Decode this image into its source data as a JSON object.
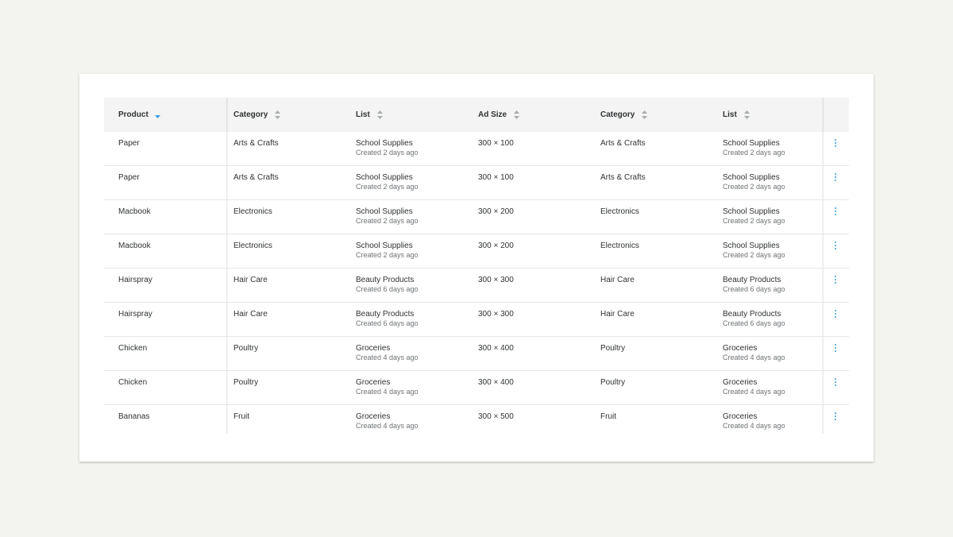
{
  "colors": {
    "background": "#f3f3ef",
    "card": "#ffffff",
    "header_bg": "#f4f4f4",
    "accent": "#3aa0e0",
    "text": "#2f3234",
    "muted": "#6e7275"
  },
  "table": {
    "sorted_column": "Product",
    "sort_direction": "descending",
    "headers": [
      "Product",
      "Category",
      "List",
      "Ad Size",
      "Category",
      "List"
    ],
    "rows": [
      {
        "product": "Paper",
        "category": "Arts & Crafts",
        "list": "School Supplies",
        "list_created": "Created 2 days ago",
        "ad_size": "300 × 100",
        "category2": "Arts & Crafts",
        "list2": "School Supplies",
        "list2_created": "Created 2 days ago"
      },
      {
        "product": "Paper",
        "category": "Arts & Crafts",
        "list": "School Supplies",
        "list_created": "Created 2 days ago",
        "ad_size": "300 × 100",
        "category2": "Arts & Crafts",
        "list2": "School Supplies",
        "list2_created": "Created 2 days ago"
      },
      {
        "product": "Macbook",
        "category": "Electronics",
        "list": "School Supplies",
        "list_created": "Created 2 days ago",
        "ad_size": "300 × 200",
        "category2": "Electronics",
        "list2": "School Supplies",
        "list2_created": "Created 2 days ago"
      },
      {
        "product": "Macbook",
        "category": "Electronics",
        "list": "School Supplies",
        "list_created": "Created 2 days ago",
        "ad_size": "300 × 200",
        "category2": "Electronics",
        "list2": "School Supplies",
        "list2_created": "Created 2 days ago"
      },
      {
        "product": "Hairspray",
        "category": "Hair Care",
        "list": "Beauty Products",
        "list_created": "Created 6 days ago",
        "ad_size": "300 × 300",
        "category2": "Hair Care",
        "list2": "Beauty Products",
        "list2_created": "Created 6 days ago"
      },
      {
        "product": "Hairspray",
        "category": "Hair Care",
        "list": "Beauty Products",
        "list_created": "Created 6 days ago",
        "ad_size": "300 × 300",
        "category2": "Hair Care",
        "list2": "Beauty Products",
        "list2_created": "Created 6 days ago"
      },
      {
        "product": "Chicken",
        "category": "Poultry",
        "list": "Groceries",
        "list_created": "Created 4 days ago",
        "ad_size": "300 × 400",
        "category2": "Poultry",
        "list2": "Groceries",
        "list2_created": "Created 4 days ago"
      },
      {
        "product": "Chicken",
        "category": "Poultry",
        "list": "Groceries",
        "list_created": "Created 4 days ago",
        "ad_size": "300 × 400",
        "category2": "Poultry",
        "list2": "Groceries",
        "list2_created": "Created 4 days ago"
      },
      {
        "product": "Bananas",
        "category": "Fruit",
        "list": "Groceries",
        "list_created": "Created 4 days ago",
        "ad_size": "300 × 500",
        "category2": "Fruit",
        "list2": "Groceries",
        "list2_created": "Created 4 days ago"
      }
    ]
  },
  "icons": {
    "sort_active": "sort-descending-icon",
    "sort_inactive": "sort-icon",
    "row_menu": "more-vertical-icon"
  }
}
